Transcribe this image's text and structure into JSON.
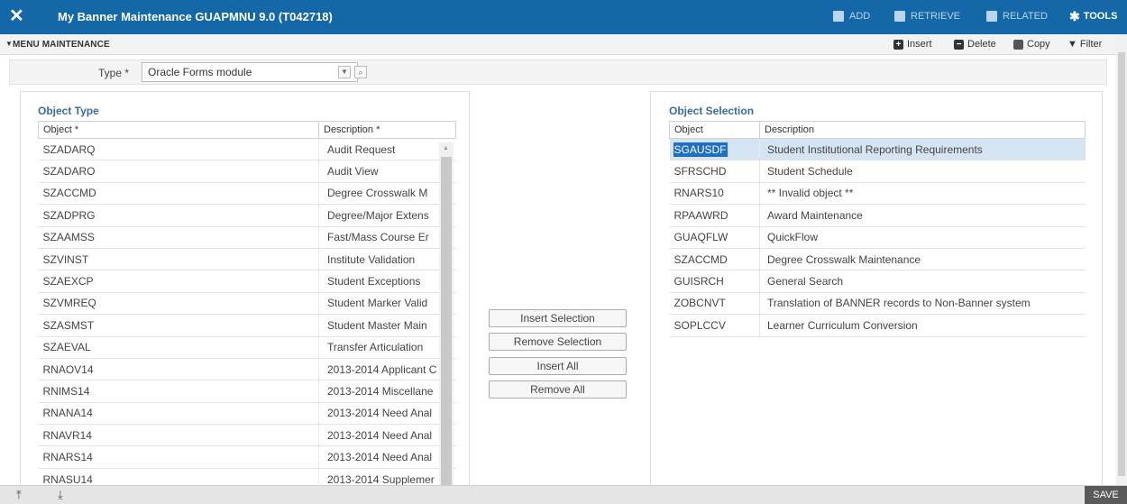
{
  "header": {
    "close_glyph": "✕",
    "title": "My Banner Maintenance GUAPMNU 9.0 (T042718)",
    "add": "ADD",
    "retrieve": "RETRIEVE",
    "related": "RELATED",
    "tools": "TOOLS"
  },
  "section": {
    "title": "MENU MAINTENANCE",
    "insert": "Insert",
    "delete": "Delete",
    "copy": "Copy",
    "filter": "Filter"
  },
  "type_field": {
    "label": "Type *",
    "value": "Oracle Forms module"
  },
  "object_type": {
    "title": "Object Type",
    "col_object": "Object *",
    "col_desc": "Description *",
    "rows": [
      {
        "object": "SZADARQ",
        "desc": "Audit Request"
      },
      {
        "object": "SZADARO",
        "desc": "Audit View"
      },
      {
        "object": "SZACCMD",
        "desc": "Degree Crosswalk M"
      },
      {
        "object": "SZADPRG",
        "desc": "Degree/Major Extens"
      },
      {
        "object": "SZAAMSS",
        "desc": "Fast/Mass Course Er"
      },
      {
        "object": "SZVINST",
        "desc": "Institute Validation"
      },
      {
        "object": "SZAEXCP",
        "desc": "Student Exceptions"
      },
      {
        "object": "SZVMREQ",
        "desc": "Student Marker Valid"
      },
      {
        "object": "SZASMST",
        "desc": "Student Master Main"
      },
      {
        "object": "SZAEVAL",
        "desc": "Transfer Articulation"
      },
      {
        "object": "RNAOV14",
        "desc": "2013-2014 Applicant C"
      },
      {
        "object": "RNIMS14",
        "desc": "2013-2014 Miscellane"
      },
      {
        "object": "RNANA14",
        "desc": "2013-2014 Need Anal"
      },
      {
        "object": "RNAVR14",
        "desc": "2013-2014 Need Anal"
      },
      {
        "object": "RNARS14",
        "desc": "2013-2014 Need Anal"
      },
      {
        "object": "RNASU14",
        "desc": "2013-2014 Supplemer"
      }
    ]
  },
  "buttons": {
    "insert_selection": "Insert Selection",
    "remove_selection": "Remove Selection",
    "insert_all": "Insert All",
    "remove_all": "Remove All"
  },
  "object_selection": {
    "title": "Object Selection",
    "col_object": "Object",
    "col_desc": "Description",
    "rows": [
      {
        "object": "SGAUSDF",
        "desc": "Student Institutional Reporting Requirements"
      },
      {
        "object": "SFRSCHD",
        "desc": "Student Schedule"
      },
      {
        "object": "RNARS10",
        "desc": "** Invalid object **"
      },
      {
        "object": "RPAAWRD",
        "desc": "Award Maintenance"
      },
      {
        "object": "GUAQFLW",
        "desc": "QuickFlow"
      },
      {
        "object": "SZACCMD",
        "desc": "Degree Crosswalk Maintenance"
      },
      {
        "object": "GUISRCH",
        "desc": "General Search"
      },
      {
        "object": "ZOBCNVT",
        "desc": "Translation of BANNER records to Non-Banner system"
      },
      {
        "object": "SOPLCCV",
        "desc": "Learner Curriculum Conversion"
      }
    ]
  },
  "footer": {
    "save": "SAVE"
  }
}
